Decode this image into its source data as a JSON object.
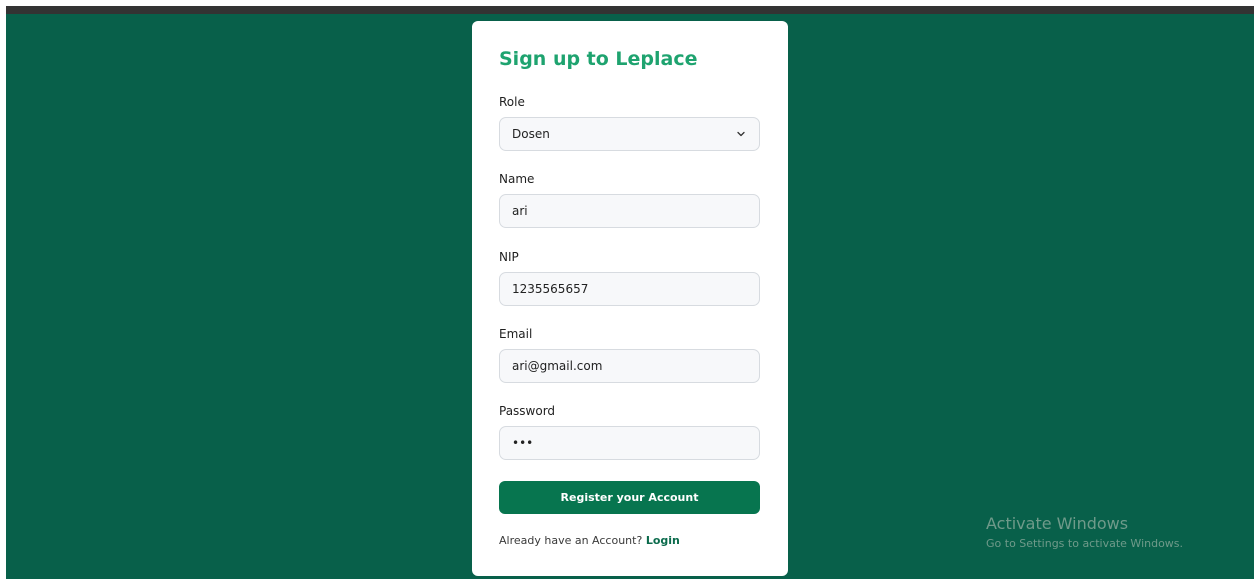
{
  "form": {
    "title": "Sign up to Leplace",
    "role": {
      "label": "Role",
      "value": "Dosen"
    },
    "name": {
      "label": "Name",
      "value": "ari"
    },
    "nip": {
      "label": "NIP",
      "value": "1235565657"
    },
    "email": {
      "label": "Email",
      "value": "ari@gmail.com"
    },
    "password": {
      "label": "Password",
      "value": "•••"
    },
    "submit_label": "Register your Account",
    "footer_text": "Already have an Account? ",
    "login_link": "Login"
  },
  "watermark": {
    "title": "Activate Windows",
    "subtitle": "Go to Settings to activate Windows."
  },
  "colors": {
    "background": "#08604a",
    "title": "#1ea36f",
    "button": "#07754f"
  },
  "icons": {
    "role_dropdown": "chevron-down-icon"
  }
}
